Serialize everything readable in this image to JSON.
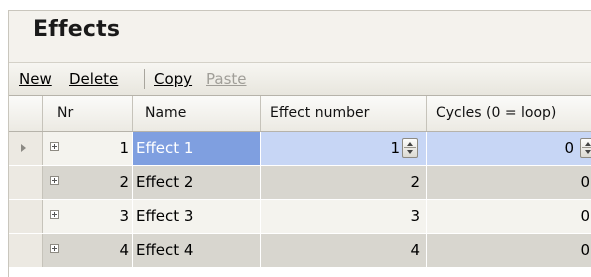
{
  "window": {
    "title": "Effects"
  },
  "toolbar": {
    "new_label": "New",
    "delete_label": "Delete",
    "copy_label": "Copy",
    "paste_label": "Paste"
  },
  "grid": {
    "columns": [
      "Nr",
      "Name",
      "Effect number",
      "Cycles (0 = loop)"
    ],
    "rows": [
      {
        "nr": "1",
        "name": "Effect 1",
        "effect_number": "1",
        "cycles": "0"
      },
      {
        "nr": "2",
        "name": "Effect 2",
        "effect_number": "2",
        "cycles": "0"
      },
      {
        "nr": "3",
        "name": "Effect 3",
        "effect_number": "3",
        "cycles": "0"
      },
      {
        "nr": "4",
        "name": "Effect 4",
        "effect_number": "4",
        "cycles": "0"
      }
    ],
    "selected_row": 1
  },
  "icons": {
    "row_pointer": "triangle-right-icon",
    "expander": "plus-box-icon",
    "spinner": "up-down-spinner-icon"
  },
  "colors": {
    "selection": "#7f9fe0",
    "row_alt": "#d8d6cf",
    "row_base": "#f4f3ee"
  }
}
